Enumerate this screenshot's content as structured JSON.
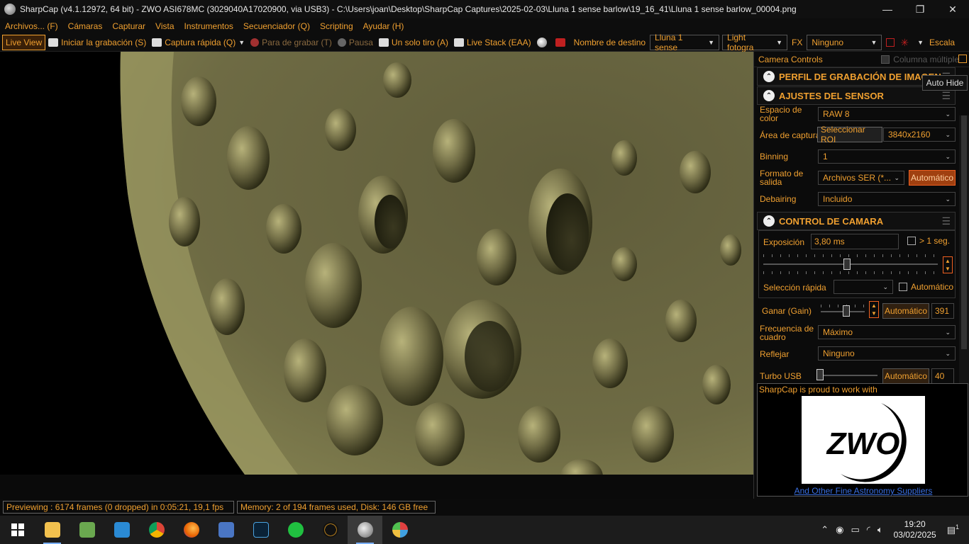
{
  "window": {
    "title": "SharpCap (v4.1.12972, 64 bit) - ZWO ASI678MC (3029040A17020900, via USB3) - C:\\Users\\joan\\Desktop\\SharpCap Captures\\2025-02-03\\Lluna 1 sense barlow\\19_16_41\\Lluna 1 sense barlow_00004.png",
    "minimize": "—",
    "maximize": "❐",
    "close": "✕"
  },
  "menu": [
    "Archivos... (F)",
    "Cámaras",
    "Capturar",
    "Vista",
    "Instrumentos",
    "Secuenciador (Q)",
    "Scripting",
    "Ayudar (H)"
  ],
  "toolbar": {
    "live_view": "Live View",
    "start_capture": "Iniciar la grabación (S)",
    "quick_capture": "Captura rápida (Q)",
    "stop_capture": "Para de grabar (T)",
    "pause": "Pausa",
    "single_frame": "Un solo tiro (A)",
    "live_stack": "Live Stack (EAA)",
    "target_name_label": "Nombre de destino",
    "target_name_value": "Lluna 1 sense",
    "frame_type": "Light fotogra",
    "fx_label": "FX",
    "fx_value": "Ninguno",
    "scale_label": "Escala"
  },
  "panel": {
    "title": "Camera Controls",
    "multi_column": "Columna múltiple",
    "tooltip": "Auto Hide",
    "sections": {
      "profile": "PERFIL DE GRABACIÓN DE IMAGEN",
      "sensor": "AJUSTES DEL SENSOR",
      "camera": "CONTROL DE CAMARA"
    },
    "sensor": {
      "color_space_label": "Espacio de color",
      "color_space_value": "RAW 8",
      "capture_area_label": "Área de captura",
      "select_roi": "Seleccionar ROI",
      "capture_area_value": "3840x2160",
      "binning_label": "Binning",
      "binning_value": "1",
      "output_format_label": "Formato de salida",
      "output_format_value": "Archivos SER (*...",
      "output_format_auto": "Automático",
      "debayer_label": "Debairing",
      "debayer_value": "Incluido"
    },
    "camera": {
      "exposure_label": "Exposición",
      "exposure_value": "3,80 ms",
      "long_exposure": "> 1 seg.",
      "exposure_slider_level": 0.48,
      "quick_select_label": "Selección rápida",
      "quick_select_value": "",
      "quick_select_auto": "Automático",
      "gain_label": "Ganar (Gain)",
      "gain_auto": "Automático",
      "gain_value": "391",
      "gain_slider_level": 0.6,
      "frame_rate_label": "Frecuencia de cuadro",
      "frame_rate_value": "Máximo",
      "flip_label": "Reflejar",
      "flip_value": "Ninguno",
      "usb_turbo_label": "Turbo USB",
      "usb_turbo_auto": "Automático",
      "usb_turbo_value": "40",
      "usb_turbo_slider_level": 0.0
    },
    "sponsor": {
      "text": "SharpCap is proud to work with",
      "logo": "ZWO",
      "link": "And Other Fine Astronomy Suppliers"
    }
  },
  "status": {
    "preview": "Previewing : 6174 frames (0 dropped) in 0:05:21, 19,1 fps",
    "memory": "Memory: 2 of 194 frames used, Disk: 146 GB free"
  },
  "taskbar": {
    "time": "19:20",
    "date": "03/02/2025",
    "notifications": "1",
    "apps": [
      "windows-start",
      "file-explorer",
      "notepad-plus",
      "vscode",
      "chrome",
      "firefox",
      "network-app",
      "lightroom-classic",
      "obs",
      "astro-app",
      "sharpcap",
      "paint"
    ]
  },
  "colors": {
    "accent": "#f0a030",
    "active_button": "#a04010"
  }
}
